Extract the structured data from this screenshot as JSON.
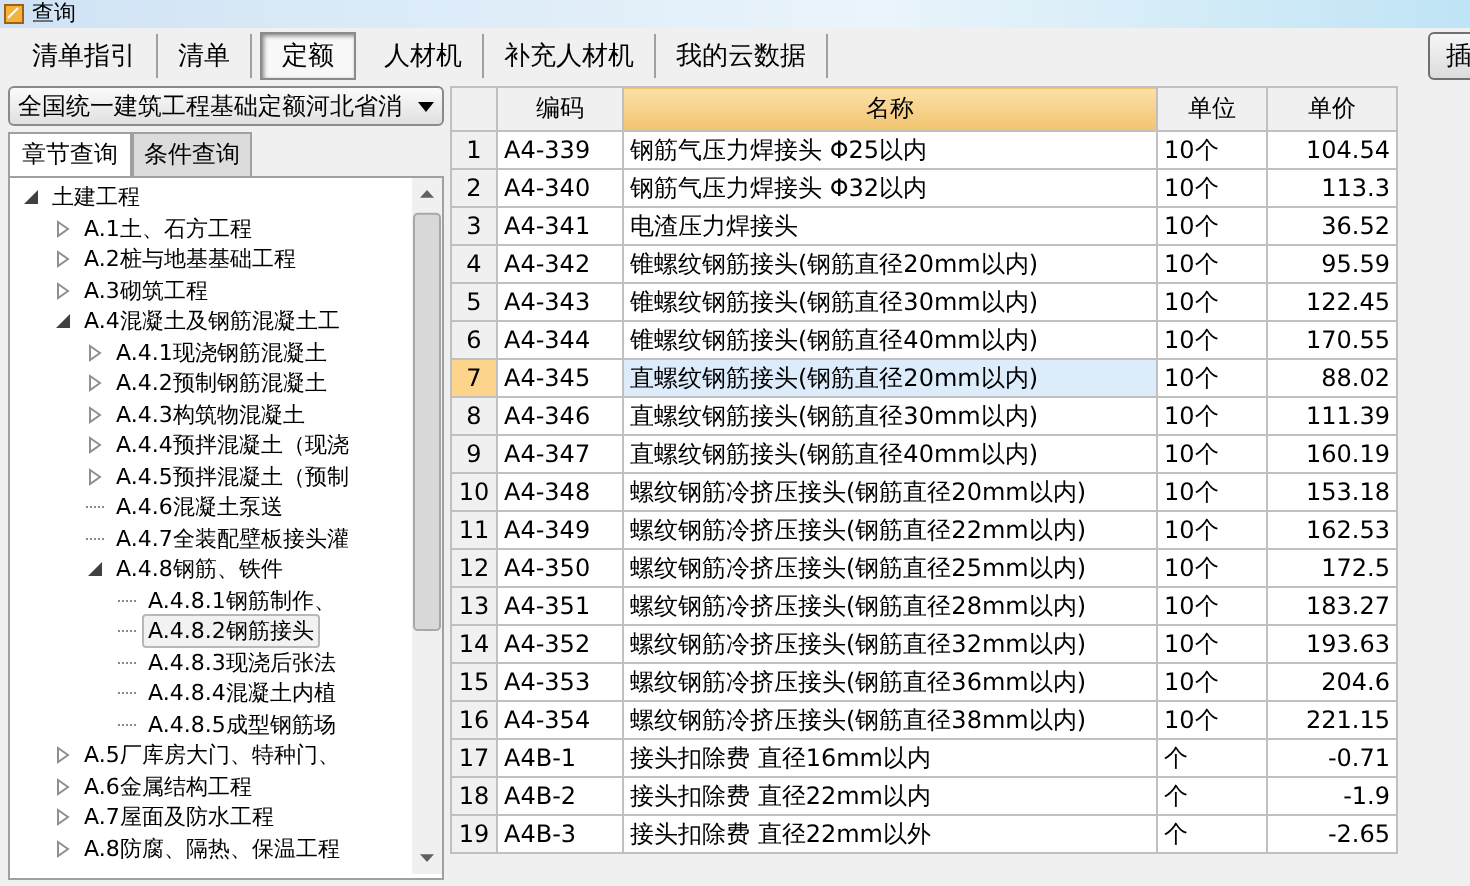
{
  "window": {
    "title": "查询"
  },
  "tabs": [
    {
      "label": "清单指引",
      "selected": false
    },
    {
      "label": "清单",
      "selected": false
    },
    {
      "label": "定额",
      "selected": true
    },
    {
      "label": "人材机",
      "selected": false
    },
    {
      "label": "补充人材机",
      "selected": false
    },
    {
      "label": "我的云数据",
      "selected": false
    }
  ],
  "right_button": {
    "label": "插"
  },
  "library_select": {
    "value": "全国统一建筑工程基础定额河北省消"
  },
  "sub_tabs": [
    {
      "label": "章节查询",
      "selected": true
    },
    {
      "label": "条件查询",
      "selected": false
    }
  ],
  "tree": [
    {
      "label": "土建工程",
      "expanded": true,
      "selected": false,
      "children": [
        {
          "label": "A.1土、石方工程",
          "expanded": false,
          "selected": false
        },
        {
          "label": "A.2桩与地基基础工程",
          "expanded": false,
          "selected": false
        },
        {
          "label": "A.3砌筑工程",
          "expanded": false,
          "selected": false
        },
        {
          "label": "A.4混凝土及钢筋混凝土工",
          "expanded": true,
          "selected": false,
          "children": [
            {
              "label": "A.4.1现浇钢筋混凝土",
              "expanded": false,
              "selected": false
            },
            {
              "label": "A.4.2预制钢筋混凝土",
              "expanded": false,
              "selected": false
            },
            {
              "label": "A.4.3构筑物混凝土",
              "expanded": false,
              "selected": false
            },
            {
              "label": "A.4.4预拌混凝土（现浇",
              "expanded": false,
              "selected": false
            },
            {
              "label": "A.4.5预拌混凝土（预制",
              "expanded": false,
              "selected": false
            },
            {
              "label": "A.4.6混凝土泵送",
              "selected": false
            },
            {
              "label": "A.4.7全装配壁板接头灌",
              "selected": false
            },
            {
              "label": "A.4.8钢筋、铁件",
              "expanded": true,
              "selected": false,
              "children": [
                {
                  "label": "A.4.8.1钢筋制作、",
                  "selected": false
                },
                {
                  "label": "A.4.8.2钢筋接头",
                  "selected": true
                },
                {
                  "label": "A.4.8.3现浇后张法",
                  "selected": false
                },
                {
                  "label": "A.4.8.4混凝土内植",
                  "selected": false
                },
                {
                  "label": "A.4.8.5成型钢筋场",
                  "selected": false
                }
              ]
            }
          ]
        },
        {
          "label": "A.5厂库房大门、特种门、",
          "expanded": false,
          "selected": false
        },
        {
          "label": "A.6金属结构工程",
          "expanded": false,
          "selected": false
        },
        {
          "label": "A.7屋面及防水工程",
          "expanded": false,
          "selected": false
        },
        {
          "label": "A.8防腐、隔热、保温工程",
          "expanded": false,
          "selected": false
        }
      ]
    }
  ],
  "table": {
    "columns": [
      {
        "label": "编码",
        "selected": false
      },
      {
        "label": "名称",
        "selected": true
      },
      {
        "label": "单位",
        "selected": false
      },
      {
        "label": "单价",
        "selected": false
      }
    ],
    "rows": [
      {
        "index": "1",
        "code": "A4-339",
        "name": "钢筋气压力焊接头 Φ25以内",
        "unit": "10个",
        "price": "104.54",
        "selected": false
      },
      {
        "index": "2",
        "code": "A4-340",
        "name": "钢筋气压力焊接头 Φ32以内",
        "unit": "10个",
        "price": "113.3",
        "selected": false
      },
      {
        "index": "3",
        "code": "A4-341",
        "name": "电渣压力焊接头",
        "unit": "10个",
        "price": "36.52",
        "selected": false
      },
      {
        "index": "4",
        "code": "A4-342",
        "name": "锥螺纹钢筋接头(钢筋直径20mm以内)",
        "unit": "10个",
        "price": "95.59",
        "selected": false
      },
      {
        "index": "5",
        "code": "A4-343",
        "name": "锥螺纹钢筋接头(钢筋直径30mm以内)",
        "unit": "10个",
        "price": "122.45",
        "selected": false
      },
      {
        "index": "6",
        "code": "A4-344",
        "name": "锥螺纹钢筋接头(钢筋直径40mm以内)",
        "unit": "10个",
        "price": "170.55",
        "selected": false
      },
      {
        "index": "7",
        "code": "A4-345",
        "name": "直螺纹钢筋接头(钢筋直径20mm以内)",
        "unit": "10个",
        "price": "88.02",
        "selected": true
      },
      {
        "index": "8",
        "code": "A4-346",
        "name": "直螺纹钢筋接头(钢筋直径30mm以内)",
        "unit": "10个",
        "price": "111.39",
        "selected": false
      },
      {
        "index": "9",
        "code": "A4-347",
        "name": "直螺纹钢筋接头(钢筋直径40mm以内)",
        "unit": "10个",
        "price": "160.19",
        "selected": false
      },
      {
        "index": "10",
        "code": "A4-348",
        "name": "螺纹钢筋冷挤压接头(钢筋直径20mm以内)",
        "unit": "10个",
        "price": "153.18",
        "selected": false
      },
      {
        "index": "11",
        "code": "A4-349",
        "name": "螺纹钢筋冷挤压接头(钢筋直径22mm以内)",
        "unit": "10个",
        "price": "162.53",
        "selected": false
      },
      {
        "index": "12",
        "code": "A4-350",
        "name": "螺纹钢筋冷挤压接头(钢筋直径25mm以内)",
        "unit": "10个",
        "price": "172.5",
        "selected": false
      },
      {
        "index": "13",
        "code": "A4-351",
        "name": "螺纹钢筋冷挤压接头(钢筋直径28mm以内)",
        "unit": "10个",
        "price": "183.27",
        "selected": false
      },
      {
        "index": "14",
        "code": "A4-352",
        "name": "螺纹钢筋冷挤压接头(钢筋直径32mm以内)",
        "unit": "10个",
        "price": "193.63",
        "selected": false
      },
      {
        "index": "15",
        "code": "A4-353",
        "name": "螺纹钢筋冷挤压接头(钢筋直径36mm以内)",
        "unit": "10个",
        "price": "204.6",
        "selected": false
      },
      {
        "index": "16",
        "code": "A4-354",
        "name": "螺纹钢筋冷挤压接头(钢筋直径38mm以内)",
        "unit": "10个",
        "price": "221.15",
        "selected": false
      },
      {
        "index": "17",
        "code": "A4B-1",
        "name": "接头扣除费 直径16mm以内",
        "unit": "个",
        "price": "-0.71",
        "selected": false
      },
      {
        "index": "18",
        "code": "A4B-2",
        "name": "接头扣除费 直径22mm以内",
        "unit": "个",
        "price": "-1.9",
        "selected": false
      },
      {
        "index": "19",
        "code": "A4B-3",
        "name": "接头扣除费 直径22mm以外",
        "unit": "个",
        "price": "-2.65",
        "selected": false
      }
    ]
  }
}
